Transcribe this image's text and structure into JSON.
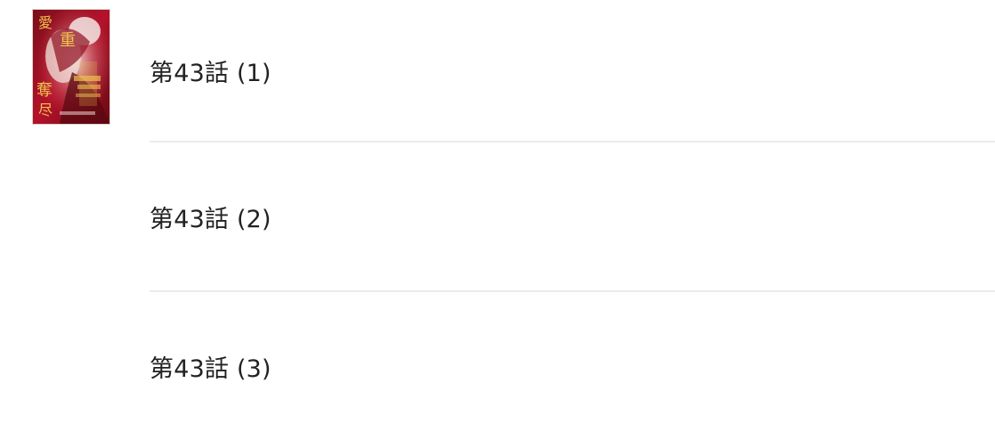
{
  "cover": {
    "title_chars": [
      "愛",
      "重",
      "奪",
      "尽"
    ]
  },
  "episodes": [
    {
      "label": "第43話 (1)"
    },
    {
      "label": "第43話 (2)"
    },
    {
      "label": "第43話 (3)"
    }
  ],
  "colors": {
    "text": "#222222",
    "divider": "#ececec",
    "cover_red": "#b3122a",
    "cover_gold": "#e0b64a"
  }
}
